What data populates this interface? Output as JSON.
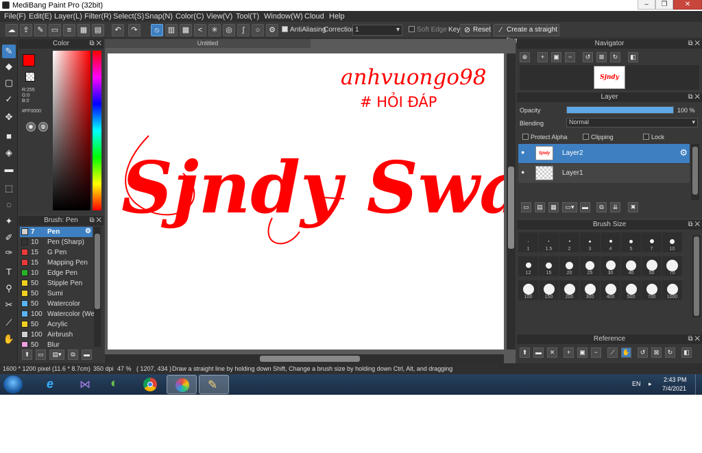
{
  "window": {
    "title": "MediBang Paint Pro (32bit)",
    "minimize": "–",
    "maximize": "❐",
    "close": "✕"
  },
  "menu": [
    "File(F)",
    "Edit(E)",
    "Layer(L)",
    "Filter(R)",
    "Select(S)",
    "Snap(N)",
    "Color(C)",
    "View(V)",
    "Tool(T)",
    "Window(W)",
    "Cloud",
    "Help"
  ],
  "toolbar": {
    "antialiasing": "AntiAliasing",
    "correction_label": "Correction",
    "correction_value": "1",
    "soft_edge": "Soft Edge",
    "key": "Key",
    "reset": "Reset",
    "straight_line": "Create a straight line"
  },
  "color_panel": {
    "title": "Color",
    "primary": "#FF0000",
    "r": "R:255",
    "g": "G:0",
    "b": "B:0",
    "hex": "#FF0000"
  },
  "brush_panel": {
    "title": "Brush: Pen",
    "items": [
      {
        "size": "7",
        "name": "Pen",
        "color": "#d0d0d0"
      },
      {
        "size": "10",
        "name": "Pen (Sharp)",
        "color": "#333333"
      },
      {
        "size": "15",
        "name": "G Pen",
        "color": "#e83a3a"
      },
      {
        "size": "15",
        "name": "Mapping Pen",
        "color": "#e83a3a"
      },
      {
        "size": "10",
        "name": "Edge Pen",
        "color": "#28b428"
      },
      {
        "size": "50",
        "name": "Stipple Pen",
        "color": "#f0d020"
      },
      {
        "size": "50",
        "name": "Sumi",
        "color": "#f0d020"
      },
      {
        "size": "50",
        "name": "Watercolor",
        "color": "#5ab4f0"
      },
      {
        "size": "100",
        "name": "Watercolor (Wet)",
        "color": "#5ab4f0"
      },
      {
        "size": "50",
        "name": "Acrylic",
        "color": "#f0d020"
      },
      {
        "size": "100",
        "name": "Airbrush",
        "color": "#d0d0d0"
      },
      {
        "size": "50",
        "name": "Blur",
        "color": "#f0a0e0"
      }
    ]
  },
  "document": {
    "tab": "Untitled",
    "text_top_line1": "anhvuongo98",
    "text_top_line2": "# HỎI ĐÁP",
    "signature": "Sjndy Swann"
  },
  "navigator": {
    "title": "Navigator",
    "thumb_text": "Sjndy Swann"
  },
  "layer_panel": {
    "title": "Layer",
    "opacity_label": "Opacity",
    "opacity_value": "100 %",
    "opacity_fraction": 1.0,
    "blending_label": "Blending",
    "blending_value": "Normal",
    "protect_alpha": "Protect Alpha",
    "clipping": "Clipping",
    "lock": "Lock",
    "layers": [
      {
        "name": "Layer2",
        "thumb": "Sjndy Swann"
      },
      {
        "name": "Layer1",
        "thumb": ""
      }
    ]
  },
  "brush_size": {
    "title": "Brush Size",
    "sizes": [
      "1",
      "1.5",
      "2",
      "3",
      "4",
      "5",
      "7",
      "10",
      "12",
      "15",
      "20",
      "25",
      "30",
      "40",
      "50",
      "70",
      "100",
      "150",
      "200",
      "300",
      "400",
      "500",
      "700",
      "1000"
    ]
  },
  "reference": {
    "title": "Reference"
  },
  "status": {
    "dims": "1600 * 1200 pixel",
    "cm": "(11.6 * 8.7cm)",
    "dpi": "350 dpi",
    "zoom": "47 %",
    "coords": "( 1207, 434 )",
    "hint": "Draw a straight line by holding down Shift, Change a brush size by holding down Ctrl, Alt, and dragging"
  },
  "taskbar": {
    "lang": "EN",
    "time": "2:43 PM",
    "date": "7/4/2021"
  }
}
